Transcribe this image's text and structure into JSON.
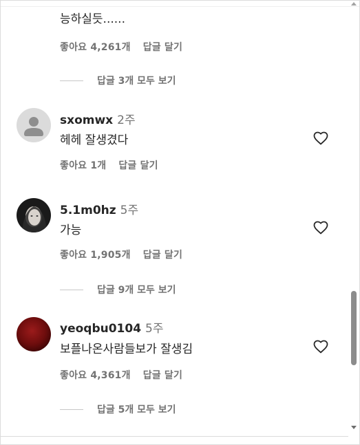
{
  "partial_comment": {
    "text": "능하실듯......",
    "likes": "좋아요 4,261개",
    "reply": "답글 달기",
    "view_replies": "답글 3개 모두 보기"
  },
  "comments": [
    {
      "username": "sxomwx",
      "age": "2주",
      "text": "헤헤 잘생겼다",
      "likes": "좋아요 1개",
      "reply": "답글 달기",
      "avatar": "default-avatar-icon"
    },
    {
      "username": "5.1m0hz",
      "age": "5주",
      "text": "가능",
      "likes": "좋아요 1,905개",
      "reply": "답글 달기",
      "view_replies": "답글 9개 모두 보기",
      "avatar": "profile-photo"
    },
    {
      "username": "yeoqbu0104",
      "age": "5주",
      "text": "보플나온사람들보가 잘생김",
      "likes": "좋아요 4,361개",
      "reply": "답글 달기",
      "view_replies": "답글 5개 모두 보기",
      "avatar": "red-profile-photo"
    }
  ],
  "colors": {
    "primary_text": "#262626",
    "secondary_text": "#737373",
    "divider": "#c7c7c7"
  }
}
